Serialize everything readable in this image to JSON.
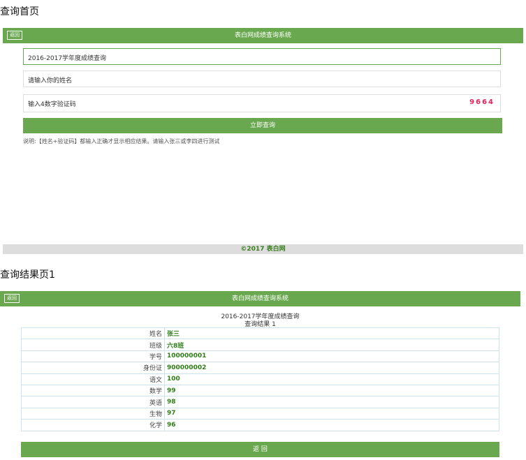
{
  "section1_title": "查询首页",
  "section2_title": "查询结果页1",
  "header": {
    "back_label": "返回",
    "title": "表白网成绩查询系统"
  },
  "form": {
    "term_value": "2016-2017学年度成绩查询",
    "name_placeholder": "请输入你的姓名",
    "code_placeholder": "输入4数字验证码",
    "captcha": "9664",
    "submit_label": "立即查询",
    "note": "说明:【姓名+验证码】都输入正确才显示相应结果。请输入张三或李四进行测试"
  },
  "footer": "©2017 表白网",
  "result": {
    "term": "2016-2017学年度成绩查询",
    "subtitle": "查询结果 1",
    "rows": [
      {
        "label": "姓名",
        "value": "张三"
      },
      {
        "label": "班级",
        "value": "六8班"
      },
      {
        "label": "学号",
        "value": "100000001"
      },
      {
        "label": "身份证",
        "value": "900000002"
      },
      {
        "label": "语文",
        "value": "100"
      },
      {
        "label": "数学",
        "value": "99"
      },
      {
        "label": "英语",
        "value": "98"
      },
      {
        "label": "生物",
        "value": "97"
      },
      {
        "label": "化学",
        "value": "96"
      }
    ],
    "back_button": "返 回"
  },
  "colors": {
    "accent": "#6aa84f",
    "captcha": "#e0245e",
    "value_text": "#2e7d16"
  }
}
